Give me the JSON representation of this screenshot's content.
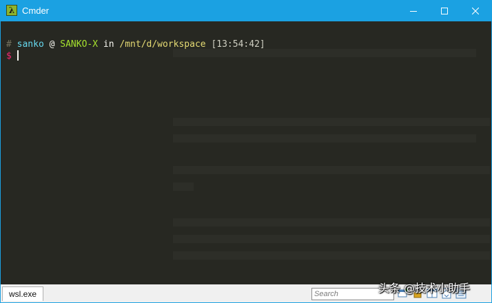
{
  "window": {
    "title": "Cmder",
    "app_icon_glyph": "λ",
    "accent_color": "#1ba1e2"
  },
  "terminal": {
    "prompt_line": {
      "hash": "#",
      "user": "sanko",
      "at": "@",
      "host": "SANKO-X",
      "in": "in",
      "path": "/mnt/d/workspace",
      "time": "[13:54:42]"
    },
    "input_line": {
      "prompt_symbol": "$",
      "text": ""
    },
    "colors": {
      "background": "#272822",
      "user": "#66d9ef",
      "host": "#a6e22e",
      "path": "#e6db74",
      "prompt": "#f92672"
    }
  },
  "statusbar": {
    "tab_label": "wsl.exe",
    "search_placeholder": "Search",
    "toolbar_icons": [
      "new-console-icon",
      "lock-icon",
      "split-icon",
      "scroll-icon",
      "menu-icon"
    ]
  },
  "watermark": {
    "text": "头条 @技术小助手"
  }
}
